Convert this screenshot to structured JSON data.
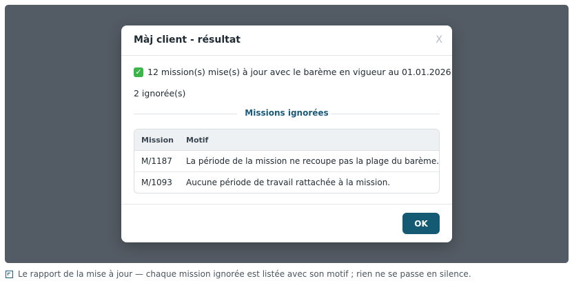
{
  "modal": {
    "title": "Màj client - résultat",
    "close_label": "X",
    "summary": "12 mission(s) mise(s) à jour avec le barème en vigueur au 01.01.2026.",
    "ignored_count": "2 ignorée(s)",
    "section_title": "Missions ignorées",
    "table": {
      "headers": {
        "mission": "Mission",
        "motif": "Motif"
      },
      "rows": [
        {
          "mission": "M/1187",
          "motif": "La période de la mission ne recoupe pas la plage du barème."
        },
        {
          "mission": "M/1093",
          "motif": "Aucune période de travail rattachée à la mission."
        }
      ]
    },
    "ok_label": "OK"
  },
  "caption": "Le rapport de la mise à jour — chaque mission ignorée est listée avec son motif ; rien ne se passe en silence.",
  "icons": {
    "success": "check-icon",
    "caption": "caption-icon"
  },
  "colors": {
    "overlay": "#535b64",
    "accent": "#145a73",
    "section_title": "#1b5a7a",
    "success": "#3bb54a"
  }
}
